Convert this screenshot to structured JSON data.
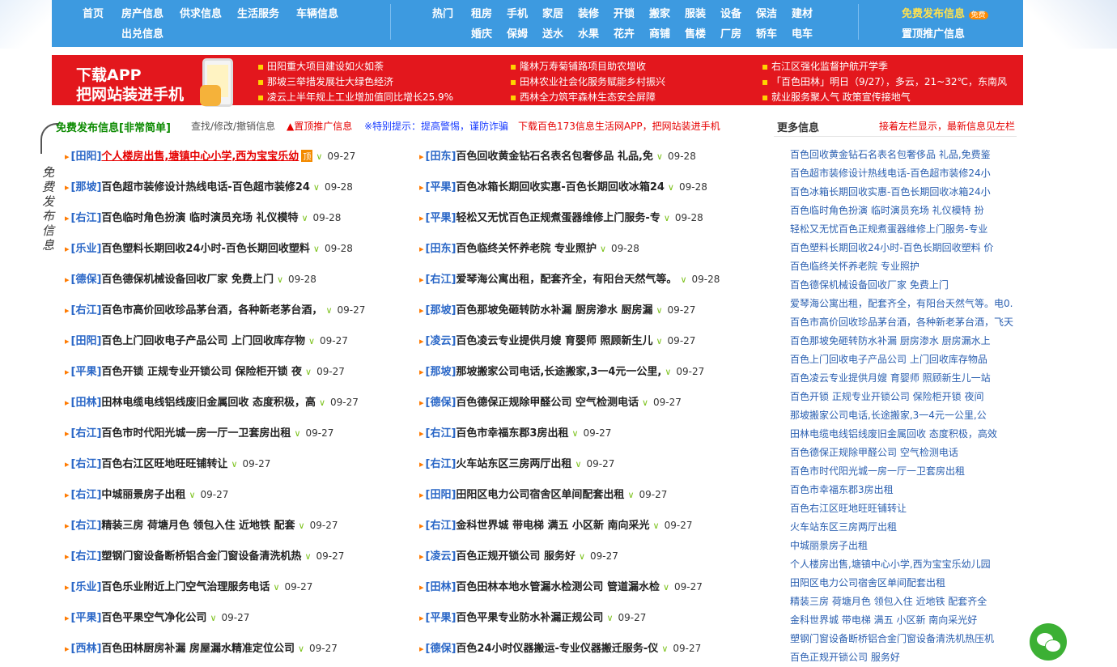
{
  "nav": {
    "row1": [
      "首页",
      "房产信息",
      "供求信息",
      "生活服务",
      "车辆信息"
    ],
    "row2": [
      "出兑信息"
    ],
    "hot_label": "热门",
    "hot1": [
      "租房",
      "手机",
      "家居",
      "装修",
      "开锁",
      "搬家",
      "服装",
      "设备",
      "保洁",
      "建材"
    ],
    "hot2": [
      "婚庆",
      "保姆",
      "送水",
      "水果",
      "花卉",
      "商铺",
      "售楼",
      "厂房",
      "轿车",
      "电车"
    ],
    "free_post": "免费发布信息",
    "free_badge": "免费",
    "top_promo": "置顶推广信息"
  },
  "banner": {
    "app_line1": "下载APP",
    "app_line2": "把网站装进手机",
    "news": [
      "田阳重大项目建设如火如荼",
      "那坡三举措发展壮大绿色经济",
      "凌云上半年规上工业增加值同比增长25.9%",
      "隆林万寿菊铺路项目助农增收",
      "田林农业社会化服务赋能乡村振兴",
      "西林全力筑牢森林生态安全屏障",
      "右江区强化监督护航开学季",
      "「百色田林」明日（9/27），多云，21~32℃，东南风",
      "就业服务聚人气 政策宣传接地气"
    ]
  },
  "tips": {
    "free": "免费发布信息[非常简单]",
    "manage": "查找/修改/撤销信息",
    "promo": "▲置顶推广信息",
    "warn": "※特别提示：提高警惕，谨防诈骗",
    "download": "下载百色173信息生活网APP，把网站装进手机"
  },
  "side_label": "免费发布信息",
  "list_left": [
    {
      "region": "[田阳]",
      "title": "个人楼房出售,塘镇中心小学,西为宝宝乐幼",
      "date": "09-27",
      "top": true
    },
    {
      "region": "[那坡]",
      "title": "百色超市装修设计热线电话-百色超市装修24",
      "date": "09-28"
    },
    {
      "region": "[右江]",
      "title": "百色临时角色扮演 临时演员充场 礼仪模特",
      "date": "09-28"
    },
    {
      "region": "[乐业]",
      "title": "百色塑料长期回收24小时-百色长期回收塑料",
      "date": "09-28"
    },
    {
      "region": "[德保]",
      "title": "百色德保机械设备回收厂家 免费上门",
      "date": "09-28"
    },
    {
      "region": "[右江]",
      "title": "百色市高价回收珍品茅台酒，各种新老茅台酒，",
      "date": "09-27"
    },
    {
      "region": "[田阳]",
      "title": "百色上门回收电子产品公司 上门回收库存物",
      "date": "09-27"
    },
    {
      "region": "[平果]",
      "title": "百色开锁 正规专业开锁公司 保险柜开锁 夜",
      "date": "09-27"
    },
    {
      "region": "[田林]",
      "title": "田林电缆电线铝线废旧金属回收 态度积极，高",
      "date": "09-27"
    },
    {
      "region": "[右江]",
      "title": "百色市时代阳光城一房一厅一卫套房出租",
      "date": "09-27"
    },
    {
      "region": "[右江]",
      "title": "百色右江区旺地旺旺铺转让",
      "date": "09-27"
    },
    {
      "region": "[右江]",
      "title": "中城丽景房子出租",
      "date": "09-27"
    },
    {
      "region": "[右江]",
      "title": "精装三房 荷塘月色 领包入住 近地铁 配套",
      "date": "09-27"
    },
    {
      "region": "[右江]",
      "title": "塑钢门窗设备断桥铝合金门窗设备清洗机热",
      "date": "09-27"
    },
    {
      "region": "[乐业]",
      "title": "百色乐业附近上门空气治理服务电话",
      "date": "09-27"
    },
    {
      "region": "[平果]",
      "title": "百色平果空气净化公司",
      "date": "09-27"
    },
    {
      "region": "[西林]",
      "title": "百色田林厨房补漏 房屋漏水精准定位公司",
      "date": "09-27"
    }
  ],
  "list_right": [
    {
      "region": "[田东]",
      "title": "百色回收黄金钻石名表名包奢侈品 礼品,免",
      "date": "09-28"
    },
    {
      "region": "[平果]",
      "title": "百色冰箱长期回收实惠-百色长期回收冰箱24",
      "date": "09-28"
    },
    {
      "region": "[平果]",
      "title": "轻松又无忧百色正规煮蛋器维修上门服务-专",
      "date": "09-28"
    },
    {
      "region": "[田东]",
      "title": "百色临终关怀养老院 专业照护",
      "date": "09-28"
    },
    {
      "region": "[右江]",
      "title": "爱琴海公寓出租，配套齐全，有阳台天然气等。",
      "date": "09-28"
    },
    {
      "region": "[那坡]",
      "title": "百色那坡免砸转防水补漏 厨房渗水 厨房漏",
      "date": "09-27"
    },
    {
      "region": "[凌云]",
      "title": "百色凌云专业提供月嫂 育婴师 照顾新生儿",
      "date": "09-27"
    },
    {
      "region": "[那坡]",
      "title": "那坡搬家公司电话,长途搬家,3一4元一公里,",
      "date": "09-27"
    },
    {
      "region": "[德保]",
      "title": "百色德保正规除甲醛公司 空气检测电话",
      "date": "09-27"
    },
    {
      "region": "[右江]",
      "title": "百色市幸福东郡3房出租",
      "date": "09-27"
    },
    {
      "region": "[右江]",
      "title": "火车站东区三房两厅出租",
      "date": "09-27"
    },
    {
      "region": "[田阳]",
      "title": "田阳区电力公司宿舍区单间配套出租",
      "date": "09-27"
    },
    {
      "region": "[右江]",
      "title": "金科世界城 带电梯 满五 小区新 南向采光",
      "date": "09-27"
    },
    {
      "region": "[凌云]",
      "title": "百色正规开锁公司 服务好",
      "date": "09-27"
    },
    {
      "region": "[田林]",
      "title": "百色田林本地水管漏水检测公司 管道漏水检",
      "date": "09-27"
    },
    {
      "region": "[平果]",
      "title": "百色平果专业防水补漏正规公司",
      "date": "09-27"
    },
    {
      "region": "[德保]",
      "title": "百色24小时仪器搬运-专业仪器搬迁服务-仪",
      "date": "09-27"
    }
  ],
  "more": {
    "title": "更多信息",
    "tip": "接着左栏显示，最新信息见左栏",
    "items": [
      "百色回收黄金钻石名表名包奢侈品 礼品,免费鉴",
      "百色超市装修设计热线电话-百色超市装修24小",
      "百色冰箱长期回收实惠-百色长期回收冰箱24小",
      "百色临时角色扮演 临时演员充场 礼仪模特 扮",
      "轻松又无忧百色正规煮蛋器维修上门服务-专业",
      "百色塑料长期回收24小时-百色长期回收塑料 价",
      "百色临终关怀养老院 专业照护",
      "百色德保机械设备回收厂家 免费上门",
      "爱琴海公寓出租，配套齐全，有阳台天然气等。电0.",
      "百色市高价回收珍品茅台酒，各种新老茅台酒，飞天",
      "百色那坡免砸转防水补漏 厨房渗水 厨房漏水上",
      "百色上门回收电子产品公司 上门回收库存物品",
      "百色凌云专业提供月嫂 育婴师 照顾新生儿一站",
      "百色开锁 正规专业开锁公司 保险柜开锁 夜间",
      "那坡搬家公司电话,长途搬家,3一4元一公里,公",
      "田林电缆电线铝线废旧金属回收 态度积极，高效",
      "百色德保正规除甲醛公司 空气检测电话",
      "百色市时代阳光城一房一厅一卫套房出租",
      "百色市幸福东郡3房出租",
      "百色右江区旺地旺旺铺转让",
      "火车站东区三房两厅出租",
      "中城丽景房子出租",
      "个人楼房出售,塘镇中心小学,西为宝宝乐幼儿园",
      "田阳区电力公司宿舍区单间配套出租",
      "精装三房 荷塘月色 领包入住 近地铁 配套齐全",
      "金科世界城 带电梯 满五 小区新 南向采光好",
      "塑钢门窗设备断桥铝合金门窗设备清洗机热压机",
      "百色正规开锁公司 服务好"
    ]
  },
  "colors": {
    "nav_bg": "#3d9ae0",
    "banner_bg": "#e3171d",
    "region": "#2a67c7",
    "link_blue": "#2a5fb0",
    "accent_red": "#e60000",
    "green": "#0b8a00"
  },
  "icons": {
    "wechat": "wechat-icon",
    "arrow": "double-arrow-icon",
    "check": "chevron-down-icon"
  }
}
